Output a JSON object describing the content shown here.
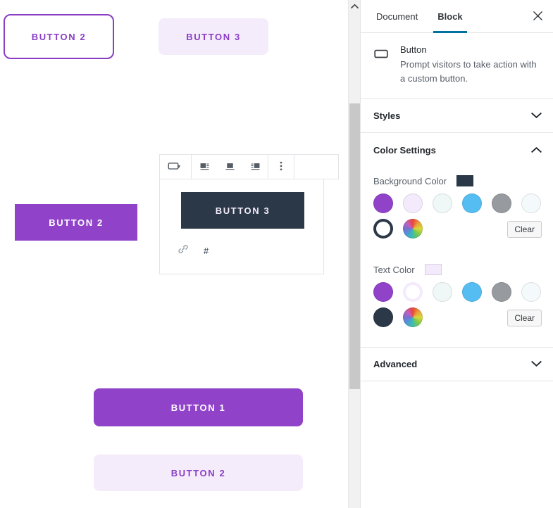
{
  "canvas": {
    "blocks": [
      {
        "name": "button-outline",
        "label": "Button 2",
        "style": "outline"
      },
      {
        "name": "button-light-top",
        "label": "Button 3",
        "style": "light-fill"
      },
      {
        "name": "button-purple-square",
        "label": "Button 2",
        "style": "purple-square"
      },
      {
        "name": "button-selected",
        "label": "Button 3",
        "style": "dark-fill"
      },
      {
        "name": "button-purple-round",
        "label": "Button 1",
        "style": "purple-round"
      },
      {
        "name": "button-light-bottom",
        "label": "Button 2",
        "style": "light-fill"
      }
    ],
    "link": {
      "icon": "link-icon",
      "url": "#"
    }
  },
  "toolbar": {
    "block_type_icon": "button-block-icon",
    "dropdown_caret": "chevron-down-icon",
    "align_left_icon": "align-left-icon",
    "align_center_icon": "align-center-icon",
    "align_right_icon": "align-right-icon",
    "more_options_icon": "more-vertical-icon"
  },
  "sidebar": {
    "tabs": [
      {
        "label": "Document",
        "active": false
      },
      {
        "label": "Block",
        "active": true
      }
    ],
    "close_icon": "close-icon",
    "block_card": {
      "icon": "button-block-icon",
      "title": "Button",
      "description": "Prompt visitors to take action with a custom button."
    },
    "panels": [
      {
        "label": "Styles",
        "open": false,
        "chevron": "chevron-down-icon"
      },
      {
        "label": "Color Settings",
        "open": true,
        "chevron": "chevron-up-icon"
      },
      {
        "label": "Advanced",
        "open": false,
        "chevron": "chevron-down-icon"
      }
    ],
    "color_settings": {
      "background": {
        "label": "Background Color",
        "current": "#2b3847",
        "clear_label": "Clear",
        "swatches": [
          {
            "name": "purple",
            "color": "#9043c9",
            "selected": false
          },
          {
            "name": "pale-lilac",
            "color": "#f3eafb",
            "selected": false
          },
          {
            "name": "pale-mint",
            "color": "#f0f7f7",
            "selected": false
          },
          {
            "name": "sky-blue",
            "color": "#56bdf2",
            "selected": false
          },
          {
            "name": "gray",
            "color": "#979b9f",
            "selected": false
          },
          {
            "name": "pale-blue",
            "color": "#f4f9fb",
            "selected": false
          },
          {
            "name": "dark-navy",
            "color": "#2b3847",
            "selected": true
          },
          {
            "name": "custom-color-picker",
            "color": "gradient",
            "selected": false
          }
        ]
      },
      "text": {
        "label": "Text Color",
        "current": "#f3eafb",
        "clear_label": "Clear",
        "swatches": [
          {
            "name": "purple",
            "color": "#9043c9",
            "selected": false
          },
          {
            "name": "pale-lilac",
            "color": "#f3eafb",
            "selected": true
          },
          {
            "name": "pale-mint",
            "color": "#f0f7f7",
            "selected": false
          },
          {
            "name": "sky-blue",
            "color": "#56bdf2",
            "selected": false
          },
          {
            "name": "gray",
            "color": "#979b9f",
            "selected": false
          },
          {
            "name": "pale-blue",
            "color": "#f4f9fb",
            "selected": false
          },
          {
            "name": "dark-navy",
            "color": "#2b3847",
            "selected": false
          },
          {
            "name": "custom-color-picker",
            "color": "gradient",
            "selected": false
          }
        ]
      }
    }
  },
  "scrollbar": {
    "up_arrow_icon": "chevron-up-icon"
  },
  "colors": {
    "accent_purple": "#9043c9",
    "accent_blue": "#0071a1",
    "dark_navy": "#2b3847",
    "border": "#e2e4e7"
  }
}
